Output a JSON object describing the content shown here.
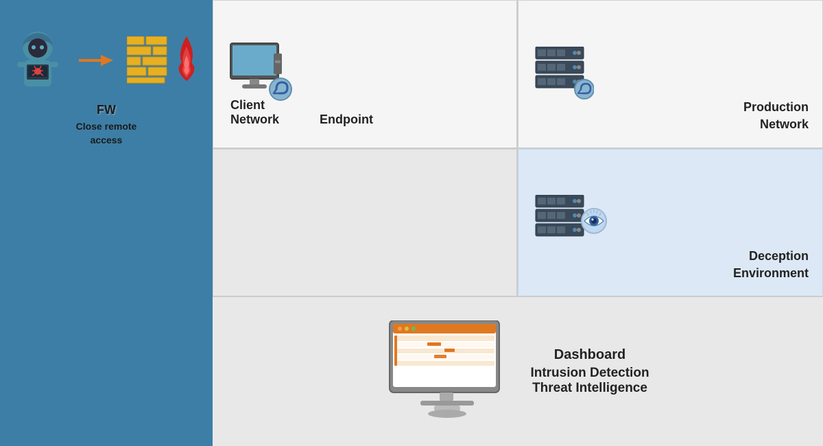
{
  "sidebar": {
    "background_color": "#3d7ea6",
    "hacker_label": "Hacker",
    "firewall_label": "FW",
    "firewall_sublabel": "Close remote\naccess",
    "arrow_char": "→"
  },
  "grid": {
    "cell1": {
      "label_line1": "Client",
      "label_line2": "Network",
      "endpoint_label": "Endpoint",
      "background": "white"
    },
    "cell2": {
      "label_line1": "Production",
      "label_line2": "Network",
      "background": "white"
    },
    "cell3": {
      "label_line1": "Deception",
      "label_line2": "Environment",
      "background": "lightblue"
    },
    "bottom": {
      "dashboard_label": "Dashboard",
      "line1": "Intrusion Detection",
      "line2": "Threat Intelligence"
    }
  }
}
